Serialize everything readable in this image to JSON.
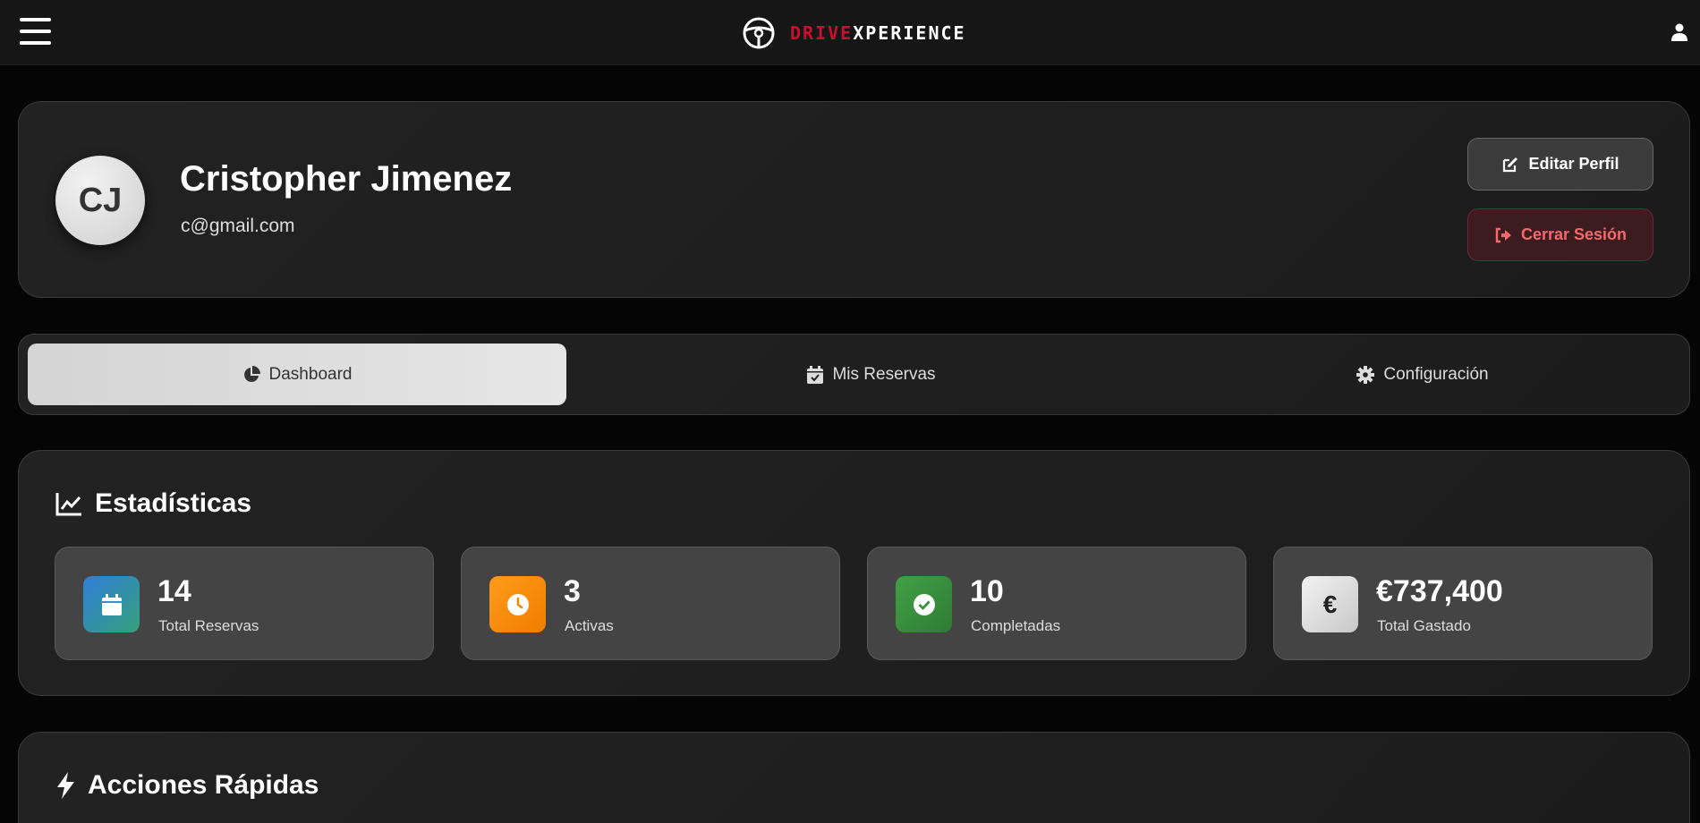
{
  "header": {
    "logo_part1": "DRIVE",
    "logo_part2": "XPERIENCE",
    "brand_red": "#c8102e",
    "icons": [
      "hamburger-menu-icon",
      "steering-wheel-icon",
      "user-icon"
    ]
  },
  "profile": {
    "initials": "CJ",
    "name": "Cristopher Jimenez",
    "email": "c@gmail.com",
    "edit_label": "Editar Perfil",
    "logout_label": "Cerrar Sesión"
  },
  "tabs": [
    {
      "label": "Dashboard",
      "icon": "pie-chart-icon",
      "active": true
    },
    {
      "label": "Mis Reservas",
      "icon": "calendar-check-icon",
      "active": false
    },
    {
      "label": "Configuración",
      "icon": "gear-icon",
      "active": false
    }
  ],
  "stats": {
    "title": "Estadísticas",
    "items": [
      {
        "value": "14",
        "label": "Total Reservas",
        "icon": "calendar-icon"
      },
      {
        "value": "3",
        "label": "Activas",
        "icon": "clock-icon"
      },
      {
        "value": "10",
        "label": "Completadas",
        "icon": "check-circle-icon"
      },
      {
        "value": "€737,400",
        "label": "Total Gastado",
        "icon": "euro-icon",
        "icon_text": "€"
      }
    ]
  },
  "actions": {
    "title": "Acciones Rápidas"
  }
}
